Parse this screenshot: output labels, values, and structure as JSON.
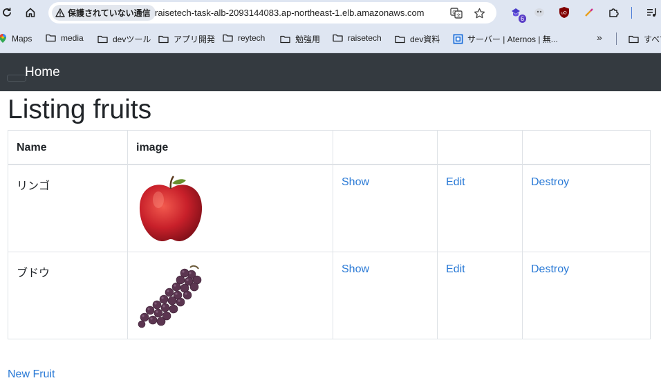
{
  "browser": {
    "security_label": "保護されていない通信",
    "url": "raisetech-task-alb-2093144083.ap-northeast-1.elb.amazonaws.com",
    "extension_badge": "6",
    "bookmarks": [
      {
        "label": "Maps",
        "icon": "maps-pin-icon"
      },
      {
        "label": "media",
        "icon": "folder-icon"
      },
      {
        "label": "devツール",
        "icon": "folder-icon"
      },
      {
        "label": "アプリ開発",
        "icon": "folder-icon"
      },
      {
        "label": "reytech",
        "icon": "folder-icon"
      },
      {
        "label": "勉強用",
        "icon": "folder-icon"
      },
      {
        "label": "raisetech",
        "icon": "folder-icon"
      },
      {
        "label": "dev資料",
        "icon": "folder-icon"
      },
      {
        "label": "サーバー | Aternos | 無...",
        "icon": "aternos-icon"
      },
      {
        "label": "すべて",
        "icon": "folder-icon"
      }
    ],
    "overflow_label": "»"
  },
  "navbar": {
    "brand": "Home"
  },
  "page": {
    "title": "Listing fruits",
    "columns": [
      "Name",
      "image",
      "",
      "",
      ""
    ],
    "rows": [
      {
        "name": "リンゴ",
        "image": "apple",
        "show": "Show",
        "edit": "Edit",
        "destroy": "Destroy"
      },
      {
        "name": "ブドウ",
        "image": "grapes",
        "show": "Show",
        "edit": "Edit",
        "destroy": "Destroy"
      }
    ],
    "new_link": "New Fruit"
  },
  "colors": {
    "navbar_bg": "#343a40",
    "link": "#2a7ad6",
    "chrome_bg": "#dfe6f2"
  }
}
